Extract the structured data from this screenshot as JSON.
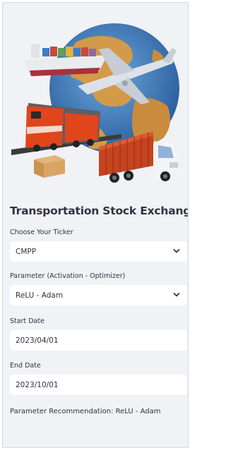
{
  "app": {
    "title": "Transportation Stock Exchange"
  },
  "hero_image": {
    "icons": [
      "globe-icon",
      "cargo-ship-icon",
      "airplane-icon",
      "locomotive-icon",
      "truck-icon",
      "parcel-box-icon"
    ],
    "colors": {
      "ocean": "#3a77b8",
      "land": "#d39a4a",
      "train": "#e0451c",
      "container": "#c5431f"
    }
  },
  "ticker": {
    "label": "Choose Your Ticker",
    "selected": "CMPP"
  },
  "parameter": {
    "label": "Parameter (Activation - Optimizer)",
    "selected": "ReLU - Adam"
  },
  "start_date": {
    "label": "Start Date",
    "value": "2023/04/01"
  },
  "end_date": {
    "label": "End Date",
    "value": "2023/10/01"
  },
  "recommendation": {
    "text": "Parameter Recommendation: ReLU - Adam"
  },
  "theme": {
    "sidebar_bg": "#f0f2f6",
    "text": "#31333f",
    "field_bg": "#ffffff"
  }
}
